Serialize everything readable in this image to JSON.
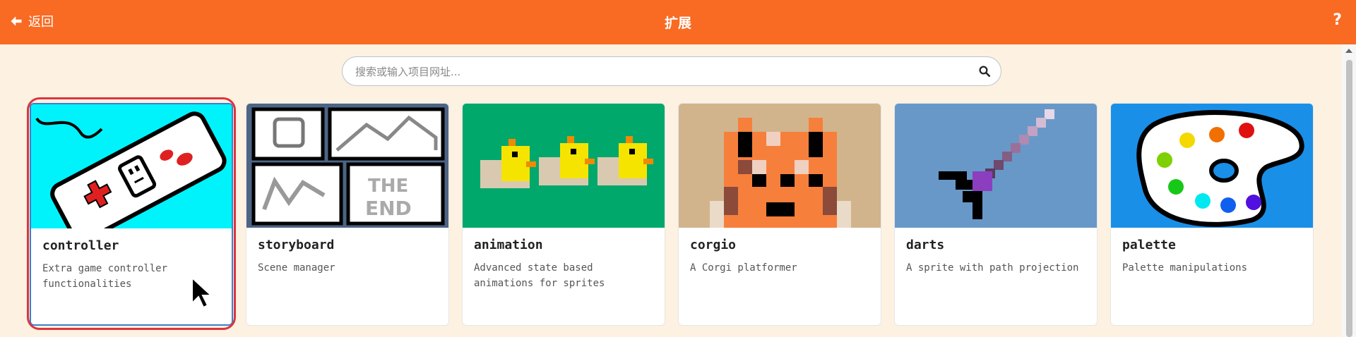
{
  "header": {
    "back_label": "返回",
    "title": "扩展",
    "help_label": "?"
  },
  "search": {
    "placeholder": "搜索或输入项目网址..."
  },
  "extensions": [
    {
      "name": "controller",
      "description": "Extra game controller functionalities",
      "selected": true
    },
    {
      "name": "storyboard",
      "description": "Scene manager"
    },
    {
      "name": "animation",
      "description": "Advanced state based animations for sprites"
    },
    {
      "name": "corgio",
      "description": "A Corgi platformer"
    },
    {
      "name": "darts",
      "description": "A sprite with path projection"
    },
    {
      "name": "palette",
      "description": "Palette manipulations"
    }
  ],
  "colors": {
    "header": "#f96a22",
    "background": "#fdf1e1",
    "highlight": "#d9363e"
  },
  "icons": [
    "arrow-left-icon",
    "search-icon",
    "mouse-pointer-icon"
  ]
}
